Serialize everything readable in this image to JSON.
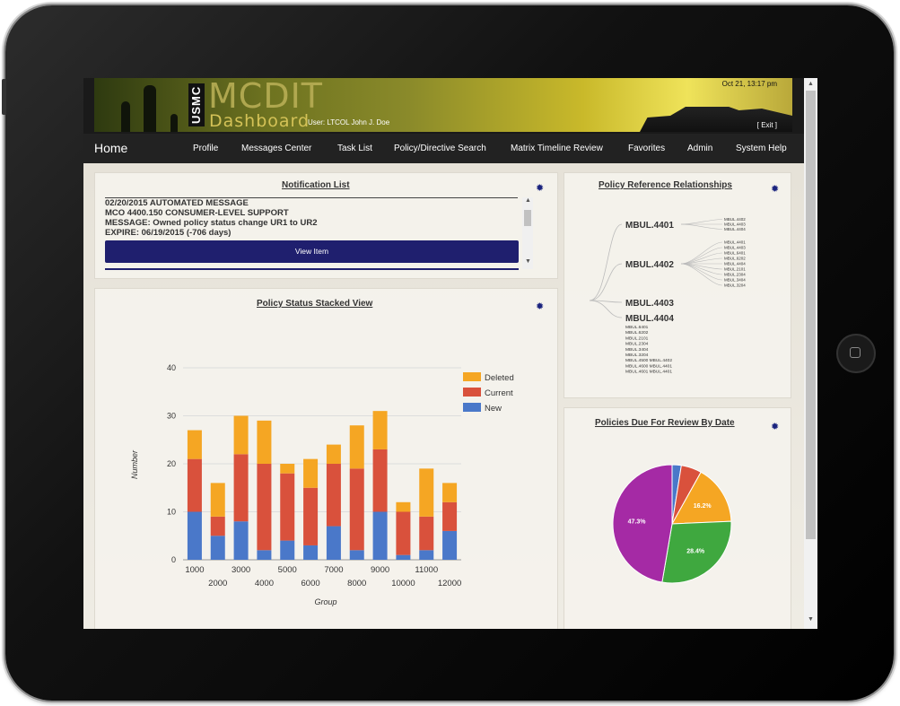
{
  "header": {
    "org_badge": "USMC",
    "app_title_line1": "MCDIT",
    "app_title_line2": "Dashboard",
    "user_line": "User: LTCOL John J. Doe",
    "datetime": "Oct 21, 13:17 pm",
    "exit_label": "[ Exit ]"
  },
  "nav": {
    "home": "Home",
    "items": [
      "Profile",
      "Messages Center",
      "Task List",
      "Policy/Directive Search",
      "Matrix Timeline Review",
      "Favorites",
      "Admin",
      "System Help"
    ]
  },
  "notification": {
    "title": "Notification List",
    "lines": [
      "02/20/2015 AUTOMATED MESSAGE",
      "MCO 4400.150 CONSUMER-LEVEL SUPPORT",
      "MESSAGE: Owned policy status change UR1 to UR2",
      "EXPIRE: 06/19/2015 (-706 days)"
    ],
    "button_label": "View Item"
  },
  "relationships": {
    "title": "Policy Reference Relationships",
    "nodes": [
      {
        "label": "MBUL.4401",
        "children": [
          "MBUL.4402",
          "MBUL.4403",
          "MBUL.4404"
        ]
      },
      {
        "label": "MBUL.4402",
        "children": [
          "MBUL.4401",
          "MBUL.4403",
          "MBUL.6401",
          "MBUL.6202",
          "MBUL.4404",
          "MBUL.2101",
          "MBUL.2304",
          "MBUL.3404",
          "MBUL.3204"
        ]
      },
      {
        "label": "MBUL.4403",
        "children": []
      },
      {
        "label": "MBUL.4404",
        "children": [
          "MBUL.6401",
          "MBUL.6202",
          "MBUL.2101",
          "MBUL.2304",
          "MBUL.3404",
          "MBUL.3204",
          "MBUL.4500 MBUL.4402",
          "MBUL.4600 MBUL.4401",
          "MBUL.4601 MBUL.4401"
        ]
      }
    ]
  },
  "chart_data": [
    {
      "type": "bar",
      "stacked": true,
      "title": "Policy Status Stacked View",
      "xlabel": "Group",
      "ylabel": "Number",
      "ylim": [
        0,
        40
      ],
      "yticks": [
        0,
        10,
        20,
        30,
        40
      ],
      "categories": [
        "1000",
        "2000",
        "3000",
        "4000",
        "5000",
        "6000",
        "7000",
        "8000",
        "9000",
        "10000",
        "11000",
        "12000"
      ],
      "series": [
        {
          "name": "New",
          "color": "#4a78c9",
          "values": [
            10,
            5,
            8,
            2,
            4,
            3,
            7,
            2,
            10,
            1,
            2,
            6
          ]
        },
        {
          "name": "Current",
          "color": "#d9513c",
          "values": [
            11,
            4,
            14,
            18,
            14,
            12,
            13,
            17,
            13,
            9,
            7,
            6
          ]
        },
        {
          "name": "Deleted",
          "color": "#f5a623",
          "values": [
            6,
            7,
            8,
            9,
            2,
            6,
            4,
            9,
            8,
            2,
            10,
            4
          ]
        }
      ],
      "legend_position": "top-right",
      "grid": true
    },
    {
      "type": "pie",
      "title": "Policies Due For Review By Date",
      "slices": [
        {
          "value": 2.5,
          "color": "#4a78c9",
          "label": ""
        },
        {
          "value": 5.6,
          "color": "#d9513c",
          "label": ""
        },
        {
          "value": 16.2,
          "color": "#f5a623",
          "label": "16.2%"
        },
        {
          "value": 28.4,
          "color": "#3fa83f",
          "label": "28.4%"
        },
        {
          "value": 47.3,
          "color": "#a52aa5",
          "label": "47.3%"
        }
      ]
    }
  ]
}
